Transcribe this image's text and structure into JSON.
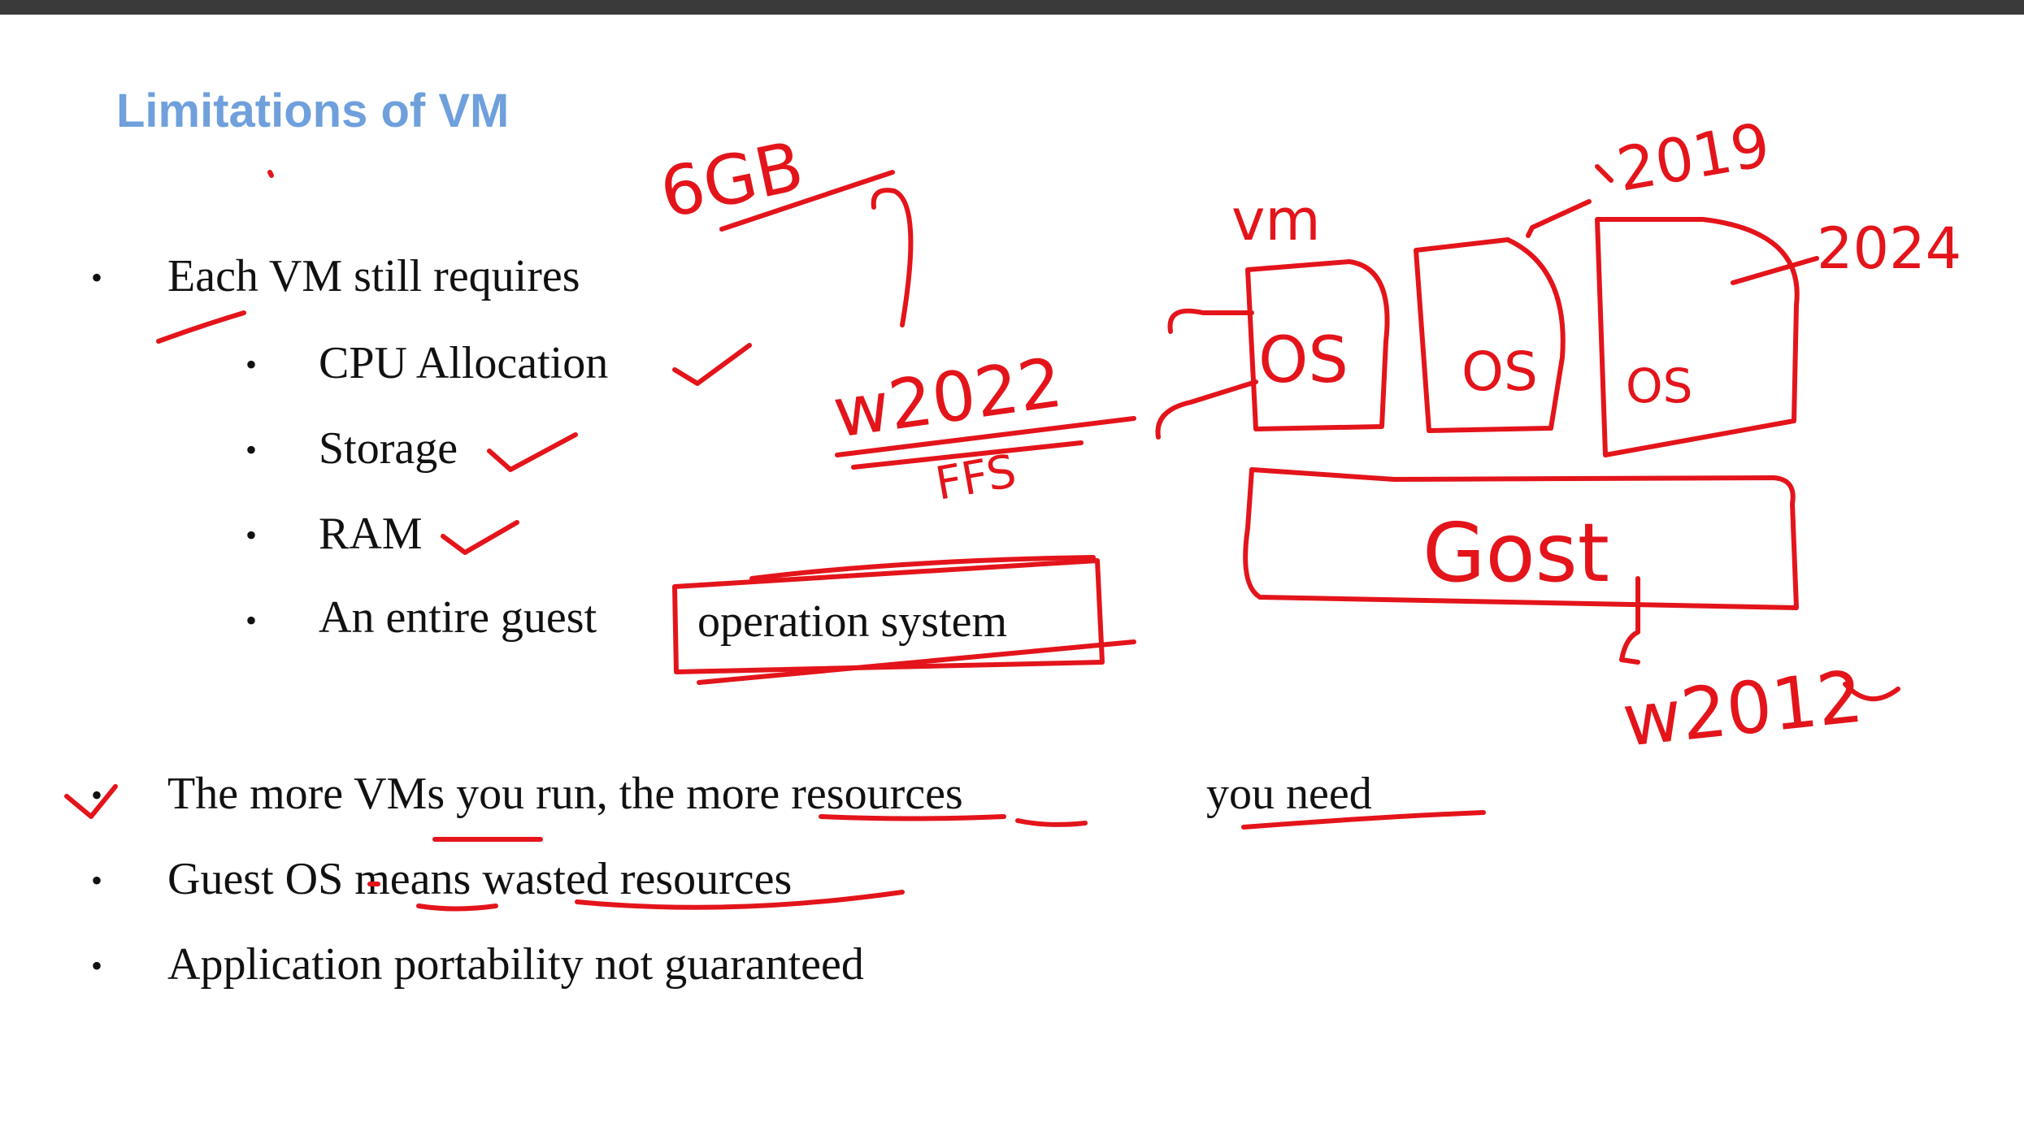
{
  "slide": {
    "title": "Limitations of VM",
    "bullets": [
      {
        "text": "Each  VM still requires"
      },
      {
        "text": "The  more VMs you  run,  the  more resources",
        "tail": "you  need"
      },
      {
        "text": "Guest OS means wasted resources"
      },
      {
        "text": "Application portability not  guaranteed"
      }
    ],
    "sub_bullets": [
      {
        "text": "CPU Allocation"
      },
      {
        "text": "Storage"
      },
      {
        "text": "RAM"
      },
      {
        "text": "An entire guest",
        "boxed": "operation system"
      }
    ]
  },
  "annotations": {
    "gb_label": "6GB",
    "w2022_label": "w2022",
    "w2022_strike_label": "FFS",
    "vm_label": "vm",
    "os_labels": [
      "OS",
      "OS",
      "OS"
    ],
    "year_2019": "2019",
    "year_2024": "2024",
    "host_label": "Gost",
    "host_os_label": "w2012"
  },
  "colors": {
    "title": "#6fa0dc",
    "ink": "#e4141b",
    "text": "#111111",
    "topbar": "#3a3a3a"
  }
}
